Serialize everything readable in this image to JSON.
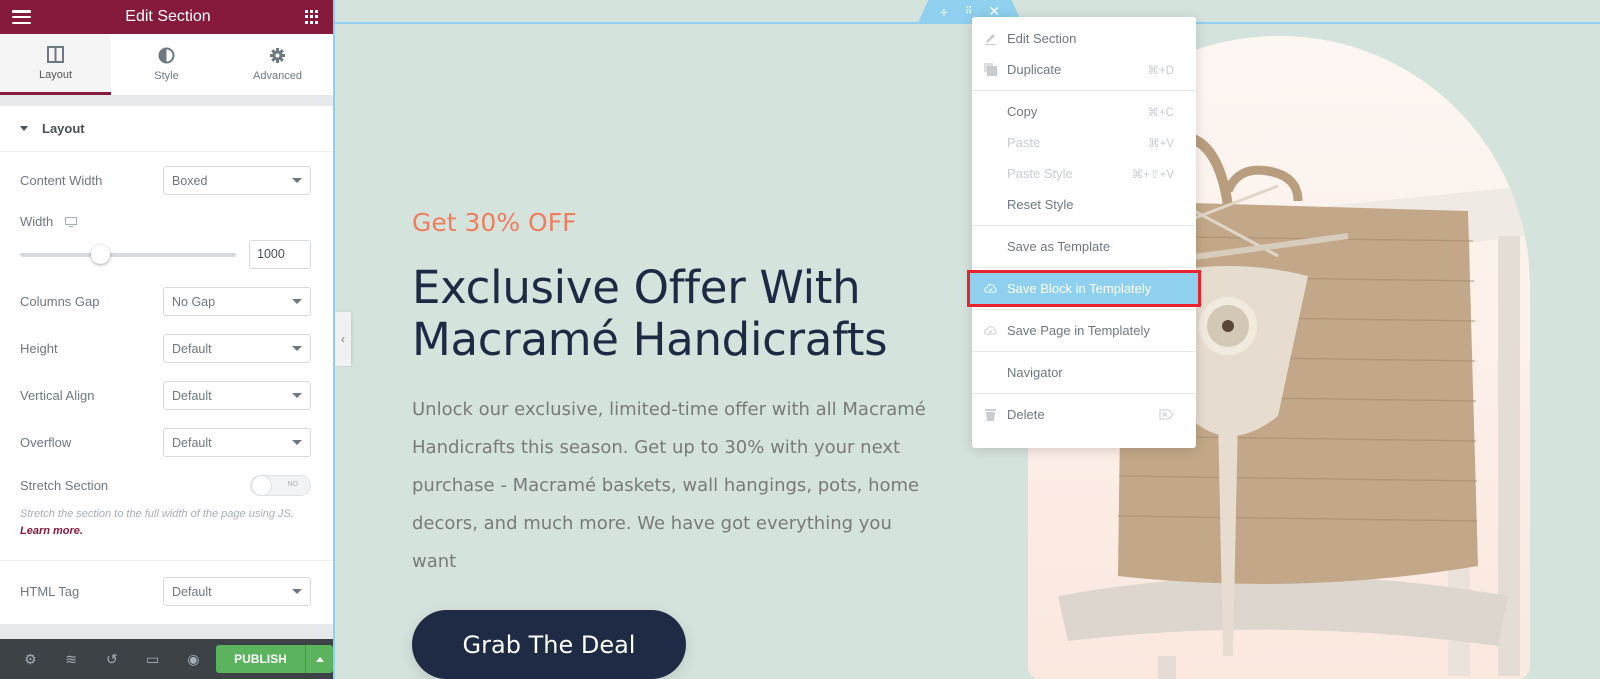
{
  "panel": {
    "title": "Edit Section",
    "tabs": [
      {
        "label": "Layout",
        "icon": "columns-icon",
        "active": true
      },
      {
        "label": "Style",
        "icon": "half-circle-icon",
        "active": false
      },
      {
        "label": "Advanced",
        "icon": "gear-icon",
        "active": false
      }
    ],
    "section_title": "Layout",
    "controls": {
      "content_width": {
        "label": "Content Width",
        "value": "Boxed"
      },
      "width": {
        "label": "Width",
        "device_icon": "desktop-icon",
        "value": "1000",
        "slider_fraction": 0.37
      },
      "columns_gap": {
        "label": "Columns Gap",
        "value": "No Gap"
      },
      "height": {
        "label": "Height",
        "value": "Default"
      },
      "vertical_align": {
        "label": "Vertical Align",
        "value": "Default"
      },
      "overflow": {
        "label": "Overflow",
        "value": "Default"
      },
      "stretch_section": {
        "label": "Stretch Section",
        "toggle_label": "NO",
        "on": false
      },
      "stretch_hint": "Stretch the section to the full width of the page using JS.",
      "learn_more": "Learn more.",
      "html_tag": {
        "label": "HTML Tag",
        "value": "Default"
      }
    },
    "footer": {
      "icons": [
        "gear-icon",
        "layers-icon",
        "history-icon",
        "responsive-icon",
        "eye-icon"
      ],
      "publish_label": "PUBLISH"
    }
  },
  "section_handle": {
    "icons": [
      "plus-icon",
      "drag-icon",
      "close-icon"
    ]
  },
  "promo": {
    "tag": "Get 30% OFF",
    "title_line1": "Exclusive Offer With",
    "title_line2": "Macramé Handicrafts",
    "body": "Unlock our exclusive, limited-time offer with all Macramé Handicrafts this season. Get up to 30% with your next purchase - Macramé baskets, wall hangings, pots, home decors, and much more. We have got everything you want",
    "cta": "Grab The Deal"
  },
  "context_menu": {
    "items": [
      {
        "label": "Edit Section",
        "icon": "pencil-icon",
        "shortcut": ""
      },
      {
        "label": "Duplicate",
        "icon": "duplicate-icon",
        "shortcut": "⌘+D"
      },
      {
        "label": "Copy",
        "shortcut": "⌘+C"
      },
      {
        "label": "Paste",
        "shortcut": "⌘+V",
        "disabled": true
      },
      {
        "label": "Paste Style",
        "shortcut": "⌘+⇧+V",
        "disabled": true
      },
      {
        "label": "Reset Style",
        "shortcut": ""
      },
      {
        "label": "Save as Template",
        "shortcut": ""
      },
      {
        "label": "Save Block in Templately",
        "icon": "cloud-icon",
        "highlighted": true
      },
      {
        "label": "Save Page in Templately",
        "icon": "cloud-icon"
      },
      {
        "label": "Navigator"
      },
      {
        "label": "Delete",
        "icon": "trash-icon",
        "shortcut_icon": "delete-key-icon"
      }
    ]
  },
  "colors": {
    "brand": "#861a3c",
    "highlight": "#8ed0ee",
    "publish": "#5bb35e",
    "accent": "#ee7e5d",
    "navy": "#1f2a45"
  }
}
